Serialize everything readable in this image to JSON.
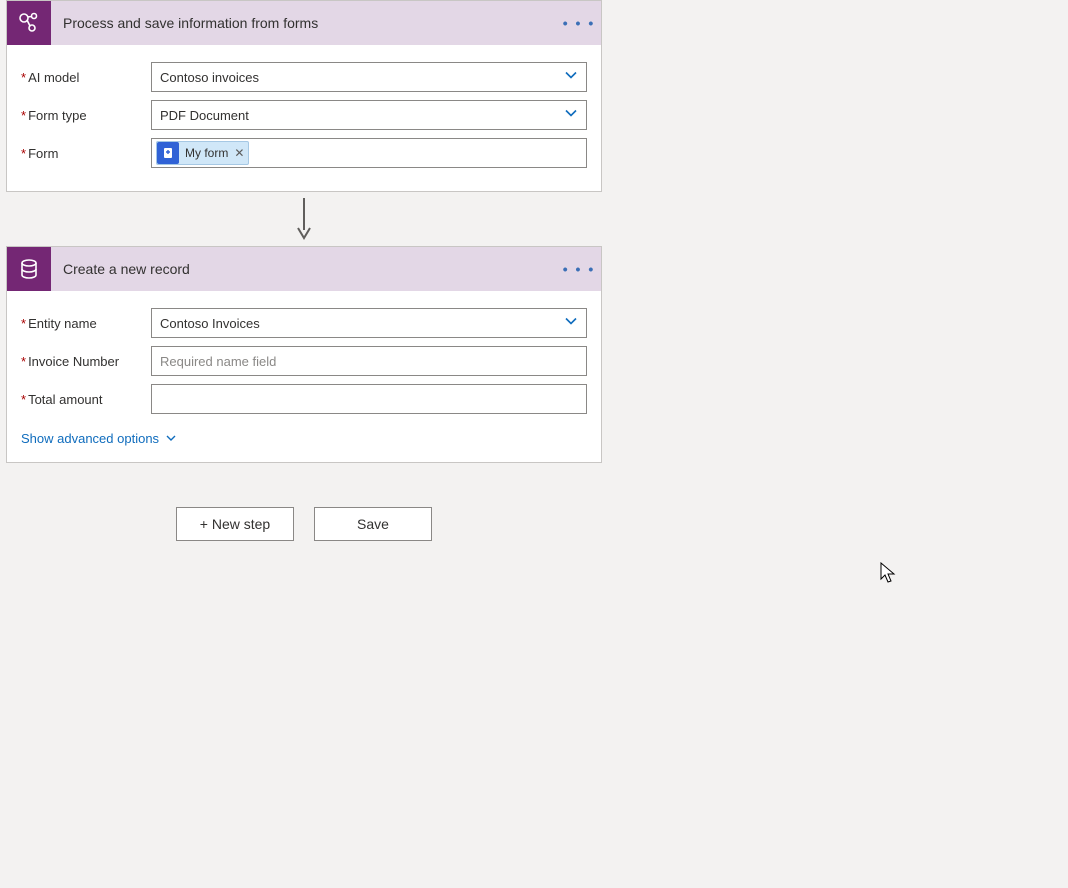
{
  "card1": {
    "title": "Process and save information from forms",
    "fields": [
      {
        "label": "AI model",
        "value": "Contoso invoices",
        "type": "select",
        "required": true
      },
      {
        "label": "Form type",
        "value": "PDF Document",
        "type": "select",
        "required": true
      },
      {
        "label": "Form",
        "token": "My form",
        "type": "token",
        "required": true
      }
    ]
  },
  "card2": {
    "title": "Create a new record",
    "fields": [
      {
        "label": "Entity name",
        "value": "Contoso Invoices",
        "type": "select",
        "required": true
      },
      {
        "label": "Invoice Number",
        "placeholder": "Required name field",
        "type": "input",
        "required": true
      },
      {
        "label": "Total amount",
        "placeholder": "",
        "type": "input",
        "required": true
      }
    ],
    "advanced_label": "Show advanced options"
  },
  "footer": {
    "new_step": "+ New step",
    "save": "Save"
  },
  "menu_dots": "• • •"
}
